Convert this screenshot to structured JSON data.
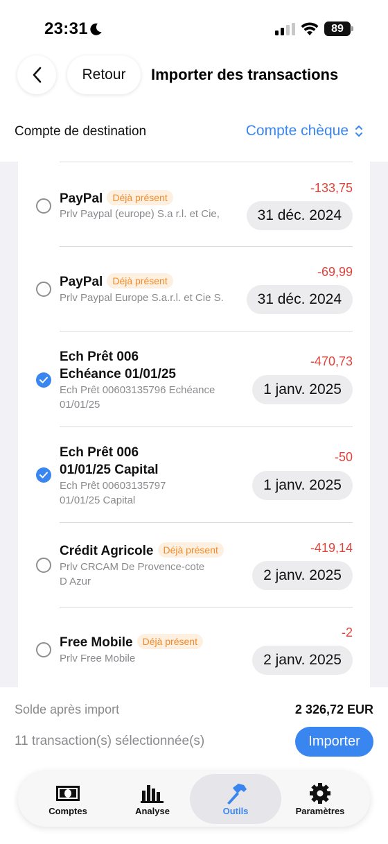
{
  "status_bar": {
    "time": "23:31",
    "battery": "89"
  },
  "header": {
    "back_icon": "chevron-left-icon",
    "retour_label": "Retour",
    "title": "Importer des transactions"
  },
  "destination": {
    "label": "Compte de destination",
    "value": "Compte chèque"
  },
  "transactions": [
    {
      "name": "PayPal",
      "badge": "Déjà présent",
      "desc": [
        "Prlv Paypal (europe) S.a r.l. et Cie,"
      ],
      "amount": "-133,75",
      "date": "31 déc. 2024",
      "selected": false
    },
    {
      "name": "PayPal",
      "badge": "Déjà présent",
      "desc": [
        "Prlv Paypal Europe S.a.r.l. et Cie S."
      ],
      "amount": "-69,99",
      "date": "31 déc. 2024",
      "selected": false
    },
    {
      "name": [
        "Ech Prêt 006",
        "Echéance 01/01/25"
      ],
      "badge": "",
      "desc": [
        "Ech Prêt 00603135796 Echéance",
        "01/01/25"
      ],
      "amount": "-470,73",
      "date": "1 janv. 2025",
      "selected": true
    },
    {
      "name": [
        "Ech Prêt 006",
        "01/01/25 Capital"
      ],
      "badge": "",
      "desc": [
        "Ech Prêt 00603135797",
        "01/01/25 Capital"
      ],
      "amount": "-50",
      "date": "1 janv. 2025",
      "selected": true
    },
    {
      "name": "Crédit Agricole",
      "badge": "Déjà présent",
      "desc": [
        "Prlv CRCAM De Provence-cote",
        "D Azur"
      ],
      "amount": "-419,14",
      "date": "2 janv. 2025",
      "selected": false
    },
    {
      "name": "Free Mobile",
      "badge": "Déjà présent",
      "desc": [
        "Prlv Free Mobile"
      ],
      "amount": "-2",
      "date": "2 janv. 2025",
      "selected": false
    }
  ],
  "footer": {
    "solde_label": "Solde après import",
    "solde_value": "2 326,72 EUR",
    "selection_label": "11 transaction(s) sélectionnée(s)",
    "import_label": "Importer"
  },
  "tabs": [
    {
      "label": "Comptes",
      "icon": "banknote-icon",
      "active": false
    },
    {
      "label": "Analyse",
      "icon": "bar-chart-icon",
      "active": false
    },
    {
      "label": "Outils",
      "icon": "hammer-icon",
      "active": true
    },
    {
      "label": "Paramètres",
      "icon": "gear-icon",
      "active": false
    }
  ],
  "colors": {
    "accent": "#3a86f0",
    "negative": "#e0433b",
    "badge_text": "#f08a2a",
    "badge_bg": "#fdf0e0"
  }
}
